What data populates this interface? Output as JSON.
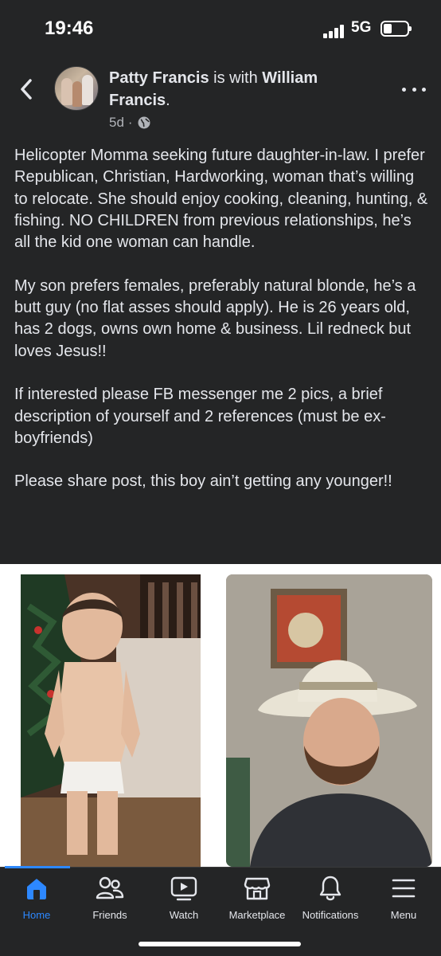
{
  "status_bar": {
    "time": "19:46",
    "network": "5G"
  },
  "post": {
    "author": "Patty Francis",
    "with_text": " is with ",
    "tagged": "William Francis",
    "tagged_suffix": ".",
    "time_ago": "5d",
    "separator": "·",
    "privacy_icon": "globe-icon",
    "paragraphs": [
      "Helicopter Momma seeking future daughter-in-law. I prefer Republican, Christian, Hardworking, woman that’s willing to relocate. She should enjoy cooking, cleaning, hunting, & fishing. NO CHILDREN from previous relationships, he’s all the kid one woman can handle.",
      "My son prefers females, preferably natural blonde, he’s a butt guy (no flat asses should apply). He is 26 years old, has 2 dogs, owns own home & business. Lil redneck but loves Jesus!!",
      "If interested please FB messenger me 2 pics, a brief description of yourself and 2 references (must be ex-boyfriends)",
      "Please share post, this boy ain’t getting any younger!!"
    ]
  },
  "bottom_nav": {
    "items": [
      {
        "label": "Home",
        "icon": "home-icon",
        "active": true
      },
      {
        "label": "Friends",
        "icon": "friends-icon",
        "active": false
      },
      {
        "label": "Watch",
        "icon": "watch-icon",
        "active": false
      },
      {
        "label": "Marketplace",
        "icon": "marketplace-icon",
        "active": false
      },
      {
        "label": "Notifications",
        "icon": "bell-icon",
        "active": false
      },
      {
        "label": "Menu",
        "icon": "menu-icon",
        "active": false
      }
    ]
  },
  "colors": {
    "background": "#242526",
    "text": "#e4e6eb",
    "secondary_text": "#b0b3b8",
    "accent": "#2d88ff"
  }
}
